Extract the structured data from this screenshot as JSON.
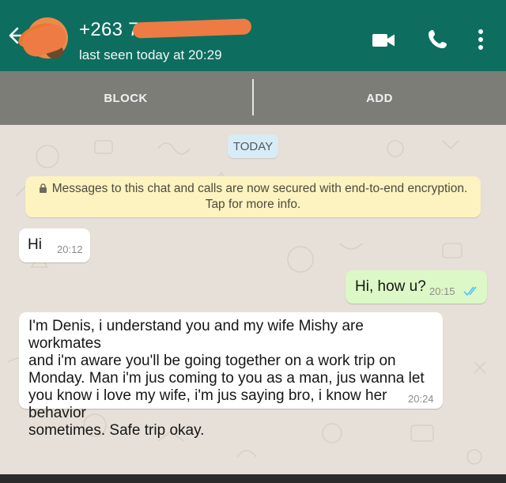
{
  "header": {
    "contact_name": "+263 77",
    "last_seen": "last seen today at 20:29",
    "icons": [
      "back-arrow-icon",
      "video-call-icon",
      "voice-call-icon",
      "more-options-icon"
    ],
    "color": "#0d6e5f"
  },
  "actions": {
    "block_label": "BLOCK",
    "add_label": "ADD"
  },
  "chat": {
    "date_chip": "TODAY",
    "encryption_notice": {
      "line1": "Messages to this chat and calls are now secured with end-to-end encryption.",
      "line2": "Tap for more info."
    },
    "messages": [
      {
        "direction": "incoming",
        "text": "Hi",
        "time": "20:12"
      },
      {
        "direction": "outgoing",
        "text": "Hi, how u?",
        "time": "20:15",
        "status": "read"
      },
      {
        "direction": "incoming",
        "lines": [
          "I'm Denis, i understand you and my wife Mishy are workmates",
          "and i'm aware you'll be going together on a work trip on",
          "Monday. Man i'm jus coming to you as a man, jus wanna let",
          "you know i love my wife, i'm jus saying bro, i know her behavior",
          "sometimes. Safe trip okay."
        ],
        "time": "20:24"
      }
    ]
  },
  "colors": {
    "incoming_bubble": "#ffffff",
    "outgoing_bubble": "#dcf8c6",
    "read_ticks": "#4fc3f7",
    "redaction": "#ee7b44"
  }
}
